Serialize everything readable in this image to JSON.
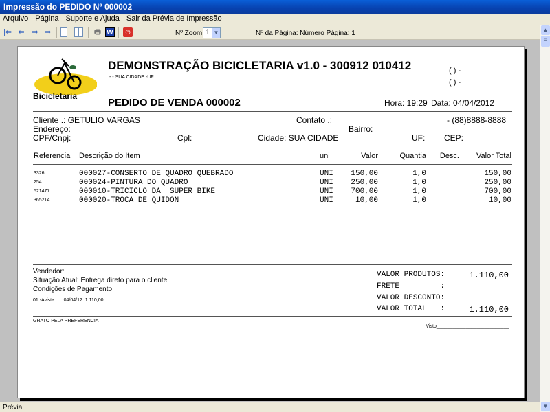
{
  "window": {
    "title": "Impressão do PEDIDO Nº 000002"
  },
  "menu": [
    "Arquivo",
    "Página",
    "Suporte e Ajuda",
    "Sair da Prévia de Impressão"
  ],
  "toolbar": {
    "zoom_label": "Nº Zoom",
    "zoom_value": "1",
    "page_label": "Nº da Página: Número Página: 1",
    "icons": [
      "first-page-icon",
      "prev-page-icon",
      "next-page-icon",
      "last-page-icon",
      "single-page-icon",
      "two-pages-icon",
      "print-icon",
      "word-export-icon",
      "exit-icon"
    ]
  },
  "report": {
    "logo_text": "Bicicletaria",
    "company": "DEMONSTRAÇÃO BICICLETARIA v1.0 - 300912 010412",
    "address": "-  - SUA CIDADE -UF",
    "phone1": "(  )    -",
    "phone2": "(  )    -",
    "order_title": "PEDIDO DE VENDA 000002",
    "time": "Hora: 19:29",
    "date": "Data: 04/04/2012",
    "cliente": "Cliente    .: GETULIO VARGAS",
    "contato": "Contato .:",
    "fone": "- (88)8888-8888",
    "endereco": "Endereço:",
    "bairro": "Bairro:",
    "cpf": "CPF/Cnpj:",
    "cpl": "Cpl:",
    "cidade": "Cidade: SUA CIDADE",
    "uf": "UF:",
    "cep": "CEP:",
    "columns": [
      "Referencia",
      "Descrição do Item",
      "uni",
      "Valor",
      "Quantia",
      "Desc.",
      "Valor Total"
    ],
    "items": [
      {
        "ref": "3326",
        "desc": "000027-CONSERTO DE QUADRO QUEBRADO",
        "uni": "UNI",
        "valor": "150,00",
        "qtd": "1,0",
        "desc_v": "",
        "total": "150,00"
      },
      {
        "ref": "254",
        "desc": "000024-PINTURA DO QUADRO",
        "uni": "UNI",
        "valor": "250,00",
        "qtd": "1,0",
        "desc_v": "",
        "total": "250,00"
      },
      {
        "ref": "521477",
        "desc": "000010-TRICICLO DA  SUPER BIKE",
        "uni": "UNI",
        "valor": "700,00",
        "qtd": "1,0",
        "desc_v": "",
        "total": "700,00"
      },
      {
        "ref": "365214",
        "desc": "000020-TROCA DE QUIDON",
        "uni": "UNI",
        "valor": "10,00",
        "qtd": "1,0",
        "desc_v": "",
        "total": "10,00"
      }
    ],
    "vendedor": "Vendedor:",
    "situacao": "Situação Atual: Entrega direto para o cliente",
    "condicoes": "Condições de Pagamento:",
    "parcela": "01 -Avista       04/04/12  1.110,00",
    "tot_produtos_label": "VALOR PRODUTOS:",
    "tot_produtos": "1.110,00",
    "frete_label": "FRETE         :",
    "frete": "",
    "desconto_label": "VALOR DESCONTO:",
    "desconto": "",
    "total_label": "VALOR TOTAL   :",
    "total": "1.110,00",
    "footer": "GRATO PELA PREFERENCIA",
    "visto": "Visto___________________________"
  },
  "status": {
    "text": "Prévia"
  }
}
